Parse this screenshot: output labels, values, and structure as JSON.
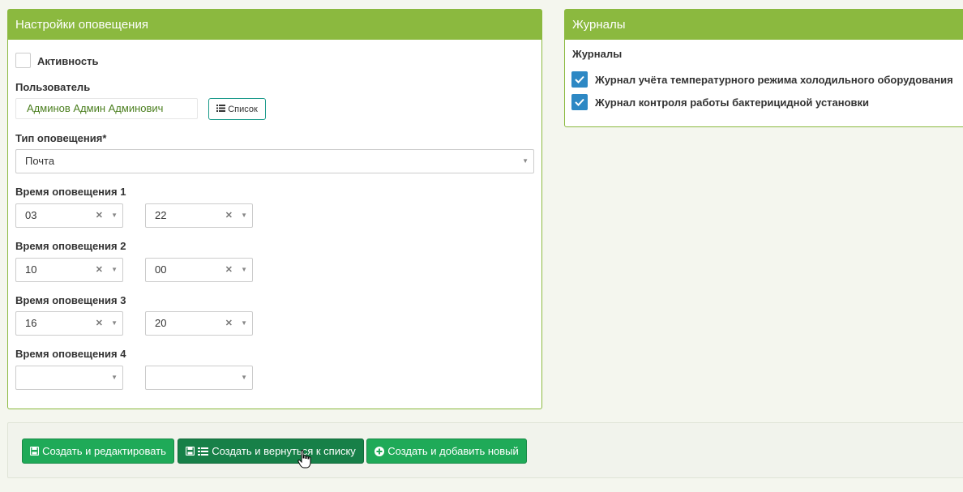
{
  "settings": {
    "title": "Настройки оповещения",
    "activity_label": "Активность",
    "user_label": "Пользователь",
    "user_value": "Админов Админ Админович",
    "list_button": "Список",
    "type_label": "Тип оповещения*",
    "type_value": "Почта",
    "times": [
      {
        "label": "Время оповещения 1",
        "hour": "03",
        "minute": "22"
      },
      {
        "label": "Время оповещения 2",
        "hour": "10",
        "minute": "00"
      },
      {
        "label": "Время оповещения 3",
        "hour": "16",
        "minute": "20"
      },
      {
        "label": "Время оповещения 4",
        "hour": "",
        "minute": ""
      }
    ]
  },
  "journals": {
    "title": "Журналы",
    "subtitle": "Журналы",
    "items": [
      {
        "label": "Журнал учёта температурного режима холодильного оборудования",
        "checked": true
      },
      {
        "label": "Журнал контроля работы бактерицидной установки",
        "checked": true
      }
    ]
  },
  "actions": {
    "create_edit": "Создать и редактировать",
    "create_return": "Создать и вернуться к списку",
    "create_new": "Создать и добавить новый"
  },
  "colors": {
    "header_green": "#8bb93f",
    "button_green": "#1faa58",
    "checkbox_blue": "#2d88c4"
  }
}
